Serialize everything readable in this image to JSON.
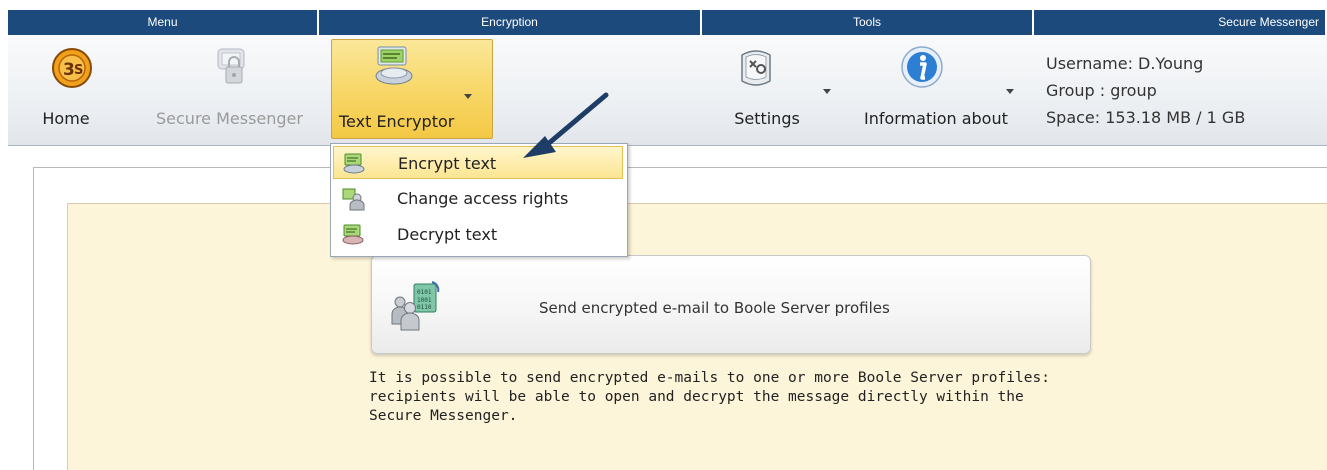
{
  "ribbon": {
    "groups": [
      {
        "title": "Menu"
      },
      {
        "title": "Encryption"
      },
      {
        "title": "Tools"
      },
      {
        "title": "Secure Messenger"
      }
    ],
    "menu": {
      "home_label": "Home",
      "secure_messenger_label": "Secure Messenger"
    },
    "encryption": {
      "text_encryptor_label": "Text Encryptor"
    },
    "tools": {
      "settings_label": "Settings",
      "information_label": "Information about"
    },
    "messenger_info": {
      "username": "Username: D.Young",
      "group": "Group : group",
      "space": "Space: 153.18 MB / 1 GB"
    }
  },
  "dropdown": {
    "items": [
      {
        "label": "Encrypt text",
        "icon": "encrypt-text-icon"
      },
      {
        "label": "Change access rights",
        "icon": "access-rights-icon"
      },
      {
        "label": "Decrypt text",
        "icon": "decrypt-text-icon"
      }
    ]
  },
  "main": {
    "card_label": "Send encrypted e-mail to Boole Server profiles",
    "description_lines": [
      "It is possible to send encrypted e-mails to one or more Boole Server profiles:",
      "recipients will be able to open and decrypt the message directly within the",
      "Secure Messenger."
    ]
  },
  "colors": {
    "ribbon_header": "#1d4a7c",
    "selected_button": "#f8d86a",
    "panel_background": "#fdf5d9",
    "pointer_arrow": "#1e3d66"
  }
}
